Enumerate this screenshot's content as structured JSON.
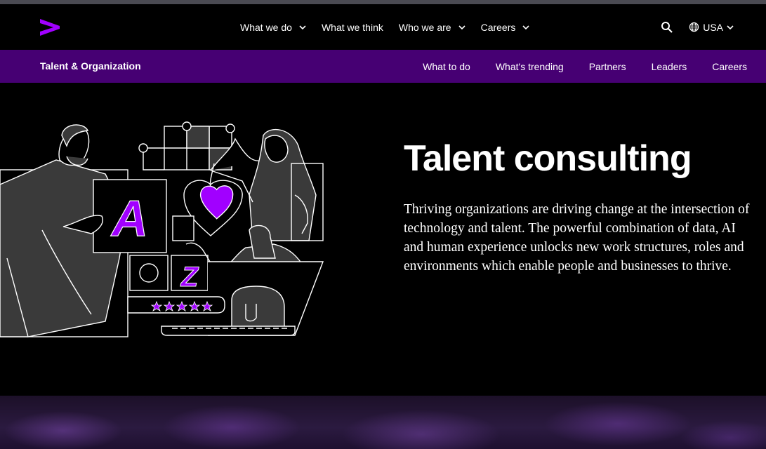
{
  "header": {
    "logo_alt": "Accenture",
    "nav": [
      {
        "label": "What we do",
        "has_dropdown": true
      },
      {
        "label": "What we think",
        "has_dropdown": false
      },
      {
        "label": "Who we are",
        "has_dropdown": true
      },
      {
        "label": "Careers",
        "has_dropdown": true
      }
    ],
    "search_icon": "search-icon",
    "language": "USA"
  },
  "subnav": {
    "title": "Talent & Organization",
    "links": [
      "What to do",
      "What's trending",
      "Partners",
      "Leaders",
      "Careers"
    ]
  },
  "hero": {
    "title": "Talent consulting",
    "body": "Thriving organizations are driving change at the intersection of technology and talent. The powerful combination of data, AI and human experience unlocks new work structures, roles and environments which enable people and businesses to thrive.",
    "illustration": {
      "letter_a": "A",
      "letter_z": "Z",
      "stars": 5
    }
  },
  "colors": {
    "brand_purple": "#A100FF",
    "subnav_bg": "#460073",
    "background": "#000000"
  }
}
